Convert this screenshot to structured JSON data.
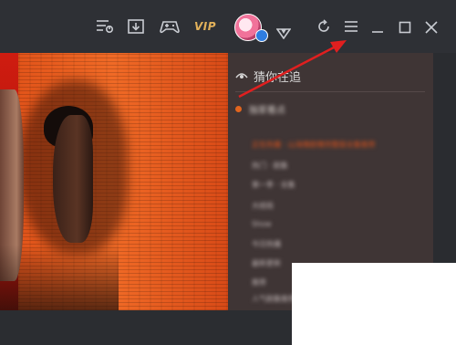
{
  "titlebar": {
    "icons": [
      "playlist-icon",
      "download-icon",
      "gamepad-icon",
      "vip-icon",
      "avatar",
      "vip-badge-icon",
      "refresh-icon",
      "menu-icon",
      "minimize-icon",
      "maximize-icon",
      "close-icon"
    ],
    "vip_label": "VIP"
  },
  "side_panel": {
    "title": "猜你在追",
    "section_label": "独家看点",
    "items": [
      "正在热播 · 山海情剧情完整版全集推荐",
      "热门 · 剧集",
      "第一季 · 全集",
      "大结局",
      "Show",
      "今日热播",
      "最新更新",
      "推荐",
      "人气剧集推荐"
    ],
    "highlight_color": "#e0531b"
  },
  "annotation": {
    "arrow_color": "#e01f1f"
  }
}
